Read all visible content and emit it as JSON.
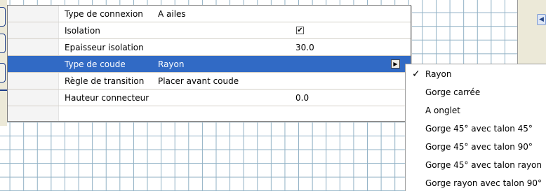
{
  "properties": [
    {
      "label": "Type de connexion",
      "value": "A ailes"
    },
    {
      "label": "Isolation",
      "value": "",
      "checked": true
    },
    {
      "label": "Epaisseur isolation",
      "value": "30.0"
    },
    {
      "label": "Type de coude",
      "value": "Rayon",
      "selected": true
    },
    {
      "label": "Règle de transition",
      "value": "Placer avant coude"
    },
    {
      "label": "Hauteur connecteur",
      "value": "0.0"
    }
  ],
  "dropdown": {
    "selected": "Rayon",
    "options": [
      "Rayon",
      "Gorge carrée",
      "A onglet",
      "Gorge 45° avec talon 45°",
      "Gorge 45° avec talon 90°",
      "Gorge 45° avec talon rayon",
      "Gorge rayon avec talon 90°"
    ]
  },
  "icons": {
    "checkmark": "check-icon",
    "dropdown_button": "dropdown-arrow-icon",
    "scroll_left": "chevron-left-icon"
  },
  "colors": {
    "selection": "#316ac5",
    "grid": "#8fb0c4",
    "chrome": "#ece9d8"
  }
}
